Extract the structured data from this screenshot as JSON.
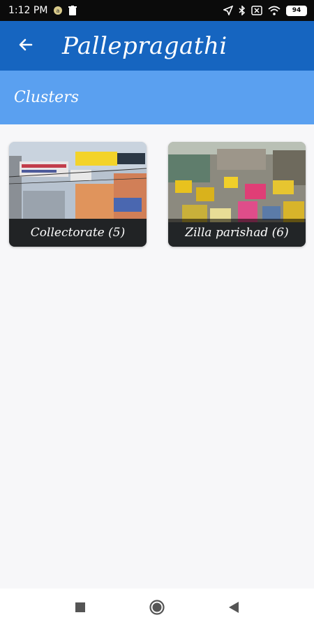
{
  "status_bar": {
    "time": "1:12 PM",
    "battery": "94",
    "icons": [
      "notification-icon",
      "trash-icon",
      "location-icon",
      "bluetooth-icon",
      "sim-icon",
      "wifi-icon",
      "battery-icon"
    ]
  },
  "app_bar": {
    "title": "Pallepragathi",
    "back_icon": "back-arrow-icon",
    "color": "#1665c0"
  },
  "section": {
    "title": "Clusters",
    "color": "#5aa0f0"
  },
  "clusters": [
    {
      "label": "Collectorate  (5)",
      "image": "street-banners-photo"
    },
    {
      "label": "Zilla parishad  (6)",
      "image": "traffic-street-photo"
    }
  ],
  "nav_bar": {
    "buttons": [
      "recents-icon",
      "home-icon",
      "back-icon"
    ]
  }
}
